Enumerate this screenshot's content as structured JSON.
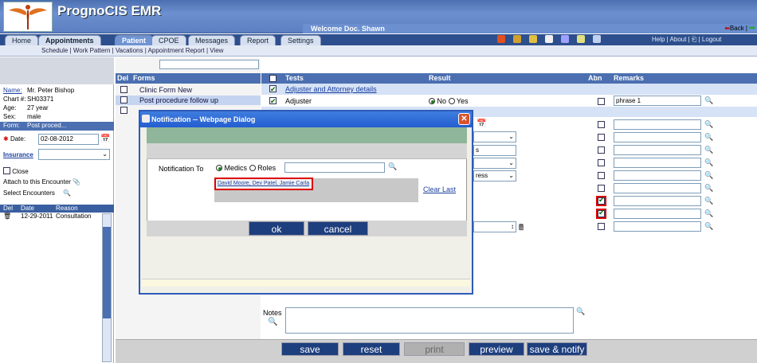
{
  "header": {
    "app_title": "PrognoCIS EMR",
    "welcome": "Welcome Doc. Shawn",
    "back": "Back |"
  },
  "tabs": [
    "Home",
    "Appointments",
    "Patient",
    "CPOE",
    "Messages",
    "Report",
    "Settings"
  ],
  "active_tab": "Patient",
  "top_links": {
    "help": "Help",
    "about": "About",
    "logout": "Logout"
  },
  "subnav": "Schedule | Work Pattern | Vacations | Appointment Report | View",
  "patient": {
    "name_label": "Name:",
    "name": "Mr. Peter Bishop",
    "chart_label": "Chart #:",
    "chart": "SH03371",
    "age_label": "Age:",
    "age": "27 year",
    "sex_label": "Sex:",
    "sex": "male",
    "form_label": "Form:",
    "form": "Post proced...",
    "date_label": "Date:",
    "date": "02-08-2012",
    "insurance_label": "Insurance",
    "close_label": "Close",
    "attach_label": "Attach to this Encounter",
    "select_enc_label": "Select Encounters"
  },
  "encounters": {
    "headers": [
      "Del",
      "Date",
      "Reason"
    ],
    "rows": [
      {
        "date": "12-29-2011",
        "reason": "Consultation"
      }
    ]
  },
  "forms": {
    "header": [
      "Del",
      "Forms"
    ],
    "items": [
      "Clinic Form New",
      "Post procedure follow up"
    ]
  },
  "tests": {
    "headers": {
      "tests": "Tests",
      "result": "Result",
      "abn": "Abn",
      "remarks": "Remarks"
    },
    "rows": [
      {
        "name": "Adjuster and Attorney details",
        "link": true
      },
      {
        "name": "Adjuster",
        "result": [
          "No",
          "Yes"
        ],
        "result_selected": "No",
        "remark": "phrase 1"
      }
    ],
    "partial_labels": [
      "s",
      "ress"
    ]
  },
  "notes_label": "Notes",
  "bottom_buttons": [
    "save",
    "reset",
    "print",
    "preview",
    "save & notify"
  ],
  "dialog": {
    "title": "Notification -- Webpage Dialog",
    "notify_label": "Notification To",
    "options": [
      "Medics",
      "Roles"
    ],
    "selected_option": "Medics",
    "recipients": "David Moore, Dev Patel, Jamie Carla",
    "clear_last": "Clear Last",
    "ok": "ok",
    "cancel": "cancel"
  }
}
